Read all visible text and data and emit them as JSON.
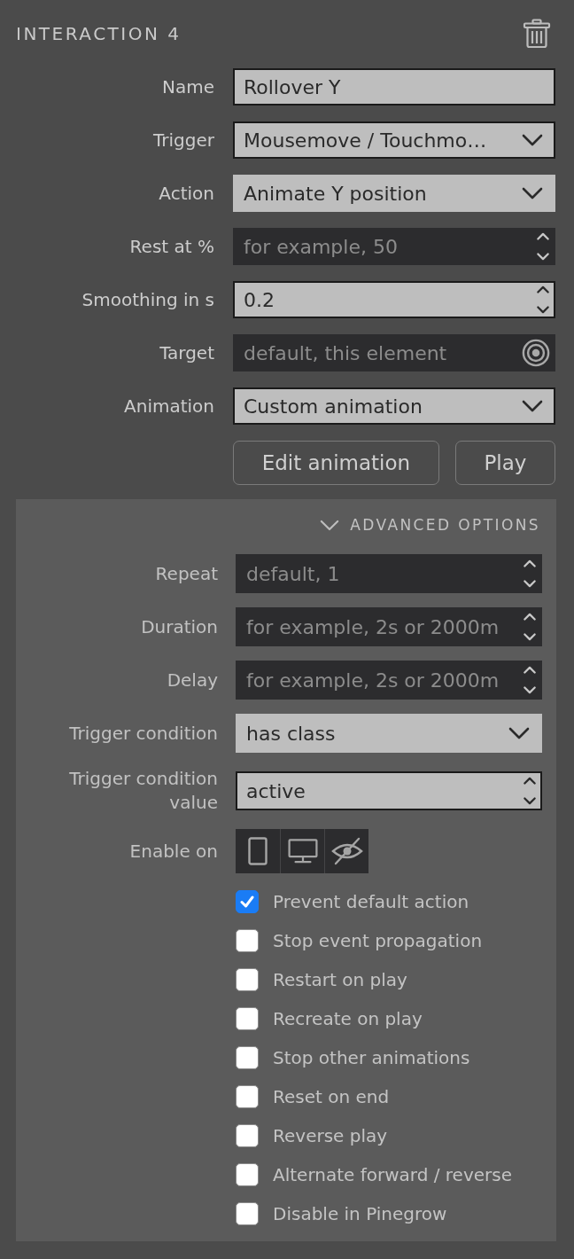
{
  "header": {
    "title": "INTERACTION 4"
  },
  "fields": [
    {
      "label": "Name",
      "kind": "text",
      "value": "Rollover Y",
      "outlined": true
    },
    {
      "label": "Trigger",
      "kind": "select",
      "value": "Mousemove / Touchmo…",
      "outlined": true
    },
    {
      "label": "Action",
      "kind": "select",
      "value": "Animate Y position",
      "outlined": false
    },
    {
      "label": "Rest at %",
      "kind": "number",
      "placeholder": "for example, 50",
      "outlined": false
    },
    {
      "label": "Smoothing in s",
      "kind": "number",
      "value": "0.2",
      "outlined": true
    },
    {
      "label": "Target",
      "kind": "picker",
      "placeholder": "default, this element",
      "outlined": false
    },
    {
      "label": "Animation",
      "kind": "select",
      "value": "Custom animation",
      "outlined": true
    }
  ],
  "buttons": [
    {
      "label": "Edit animation"
    },
    {
      "label": "Play"
    }
  ],
  "advanced": {
    "title": "ADVANCED OPTIONS",
    "expanded": true,
    "fields": [
      {
        "label": "Repeat",
        "kind": "number",
        "placeholder": "default, 1",
        "outlined": false
      },
      {
        "label": "Duration",
        "kind": "number",
        "placeholder": "for example, 2s or 2000m",
        "outlined": false
      },
      {
        "label": "Delay",
        "kind": "number",
        "placeholder": "for example, 2s or 2000m",
        "outlined": false
      },
      {
        "label": "Trigger condition",
        "kind": "select",
        "value": "has class",
        "outlined": false
      },
      {
        "label": "Trigger condition value",
        "kind": "number",
        "value": "active",
        "outlined": true
      }
    ],
    "enable_on": {
      "label": "Enable on",
      "options": [
        {
          "kind": "phone",
          "selected": false
        },
        {
          "kind": "desktop",
          "selected": false
        },
        {
          "kind": "hidden",
          "selected": false
        }
      ]
    },
    "checkboxes": [
      {
        "label": "Prevent default action",
        "checked": true
      },
      {
        "label": "Stop event propagation",
        "checked": false
      },
      {
        "label": "Restart on play",
        "checked": false
      },
      {
        "label": "Recreate on play",
        "checked": false
      },
      {
        "label": "Stop other animations",
        "checked": false
      },
      {
        "label": "Reset on end",
        "checked": false
      },
      {
        "label": "Reverse play",
        "checked": false
      },
      {
        "label": "Alternate forward / reverse",
        "checked": false
      },
      {
        "label": "Disable in Pinegrow",
        "checked": false
      }
    ]
  }
}
